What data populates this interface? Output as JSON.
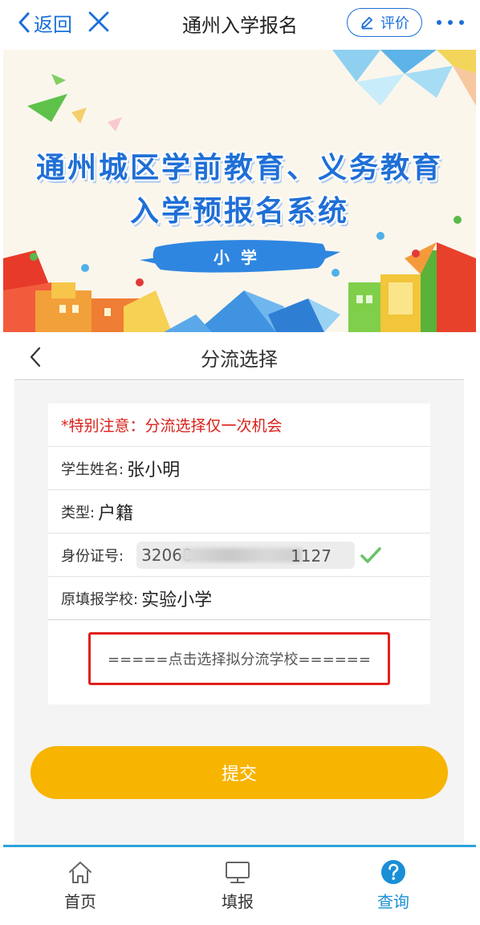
{
  "nav": {
    "back_label": "返回",
    "title": "通州入学报名",
    "rate_label": "评价"
  },
  "banner": {
    "line1": "通州城区学前教育、义务教育",
    "line2": "入学预报名系统",
    "tag": "小学"
  },
  "page": {
    "title": "分流选择"
  },
  "form": {
    "notice": "*特别注意：分流选择仅一次机会",
    "student_name_label": "学生姓名:",
    "student_name": "张小明",
    "type_label": "类型:",
    "type_value": "户籍",
    "id_label": "身份证号:",
    "id_prefix": "32068",
    "id_suffix": "1127",
    "school_label": "原填报学校:",
    "school_value": "实验小学",
    "select_school": "=====点击选择拟分流学校======"
  },
  "submit_label": "提交",
  "tabs": [
    {
      "label": "首页",
      "icon": "home-icon"
    },
    {
      "label": "填报",
      "icon": "monitor-icon"
    },
    {
      "label": "查询",
      "icon": "question-icon",
      "active": true
    }
  ],
  "colors": {
    "accent": "#1a6fd8",
    "warning": "#d8211b",
    "submit": "#f7b400",
    "tab_active": "#1a8fd6"
  }
}
